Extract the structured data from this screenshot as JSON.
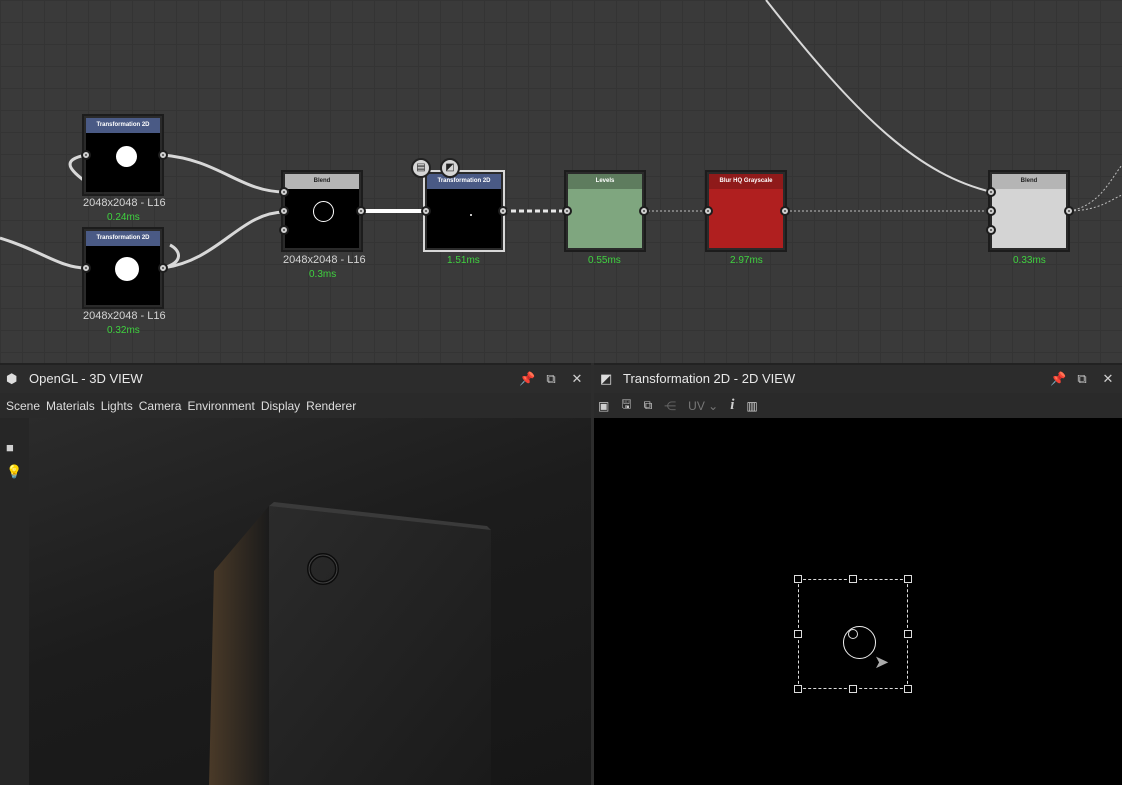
{
  "graph": {
    "nodes": {
      "t2d_top": {
        "title": "Transformation 2D",
        "size": "2048x2048 - L16",
        "time": "0.24ms"
      },
      "t2d_bottom": {
        "title": "Transformation 2D",
        "size": "2048x2048 - L16",
        "time": "0.32ms"
      },
      "blend1": {
        "title": "Blend",
        "size": "2048x2048 - L16",
        "time": "0.3ms"
      },
      "t2d_selected": {
        "title": "Transformation 2D",
        "time": "1.51ms"
      },
      "levels": {
        "title": "Levels",
        "time": "0.55ms"
      },
      "blur": {
        "title": "Blur HQ Grayscale",
        "time": "2.97ms"
      },
      "blend2": {
        "title": "Blend",
        "time": "0.33ms"
      }
    }
  },
  "view3d": {
    "title": "OpenGL - 3D VIEW",
    "menu": [
      "Scene",
      "Materials",
      "Lights",
      "Camera",
      "Environment",
      "Display",
      "Renderer"
    ]
  },
  "view2d": {
    "title": "Transformation 2D - 2D VIEW",
    "uv_label": "UV"
  },
  "colors": {
    "graph_bg": "#3a3a3a",
    "time_green": "#3fd23f",
    "levels_green": "#7fa67f",
    "blur_red": "#b01f1f",
    "node_header_blue": "#4a5a85"
  },
  "icons": [
    "pin-icon",
    "maximize-icon",
    "close-icon",
    "camera-icon",
    "light-icon",
    "cube-icon",
    "checker-icon",
    "info-icon",
    "histogram-icon",
    "save-icon",
    "copy-icon",
    "share-icon"
  ]
}
